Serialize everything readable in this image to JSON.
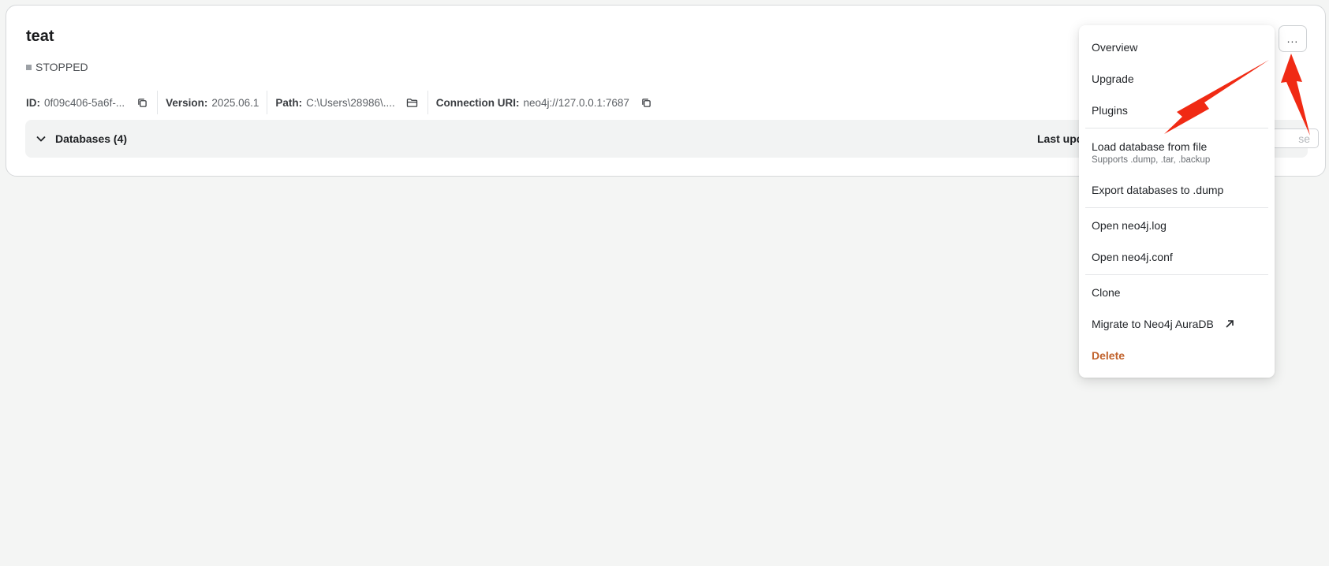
{
  "instance": {
    "name": "teat",
    "status": "STOPPED",
    "meta": [
      {
        "key": "ID:",
        "value": "0f09c406-5a6f-..."
      },
      {
        "key": "Version:",
        "value": "2025.06.1"
      },
      {
        "key": "Path:",
        "value": "C:\\Users\\28986\\...."
      },
      {
        "key": "Connection URI:",
        "value": "neo4j://127.0.0.1:7687"
      }
    ],
    "databases_label": "Databases (4)",
    "last_updated_label": "Last upd",
    "partial_button_label": "se",
    "more_label": "..."
  },
  "menu": {
    "overview": "Overview",
    "upgrade": "Upgrade",
    "plugins": "Plugins",
    "load_db": "Load database from file",
    "load_db_sub": "Supports .dump, .tar, .backup",
    "export_db": "Export databases to .dump",
    "open_log": "Open neo4j.log",
    "open_conf": "Open neo4j.conf",
    "clone": "Clone",
    "migrate": "Migrate to Neo4j AuraDB",
    "delete": "Delete"
  },
  "colors": {
    "danger": "#c0612b",
    "annotation_arrow": "#f02a14",
    "background": "#f4f5f4"
  }
}
